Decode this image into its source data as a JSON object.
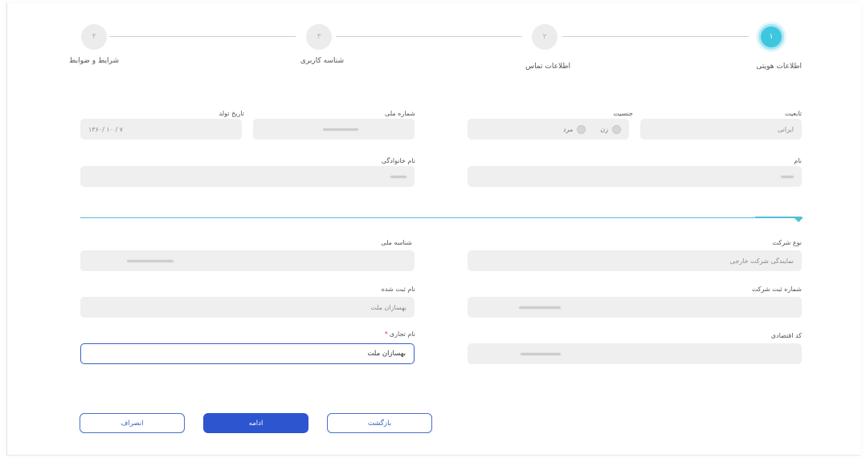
{
  "stepper": {
    "steps": [
      {
        "number": "۱",
        "label": "اطلاعات هویتی"
      },
      {
        "number": "۲",
        "label": "اطلاعات تماس"
      },
      {
        "number": "۳",
        "label": "شناسه کاربری"
      },
      {
        "number": "۴",
        "label": "شرایط و ضوابط"
      }
    ]
  },
  "personal": {
    "nationality": {
      "label": "تابعیت",
      "value": "ایرانی"
    },
    "gender": {
      "label": "جنسیت",
      "options": [
        "زن",
        "مرد"
      ]
    },
    "national_code": {
      "label": "شماره ملی"
    },
    "birth_date": {
      "label": "تاریخ تولد",
      "value": "۱۳۶۰/ ۱۰ / ۷"
    },
    "first_name": {
      "label": "نام"
    },
    "last_name": {
      "label": "نام خانوادگی"
    }
  },
  "company": {
    "company_type": {
      "label": "نوع شرکت",
      "value": "نمایندگی شرکت خارجی"
    },
    "national_id": {
      "label": "شناسه ملی"
    },
    "registration_number": {
      "label": "شماره ثبت شرکت"
    },
    "registered_name": {
      "label": "نام ثبت شده",
      "value": "بهسازان ملت"
    },
    "economic_code": {
      "label": "کد اقتصادی"
    },
    "trade_name": {
      "label": "نام تجاری",
      "required_mark": "*",
      "value": "بهسازان ملت"
    }
  },
  "buttons": {
    "back": "بازگشت",
    "continue": "ادامه",
    "cancel": "انصراف"
  },
  "colors": {
    "active_step": "#3ec6df",
    "primary": "#2c55cf",
    "divider": "#4fc0d8"
  }
}
